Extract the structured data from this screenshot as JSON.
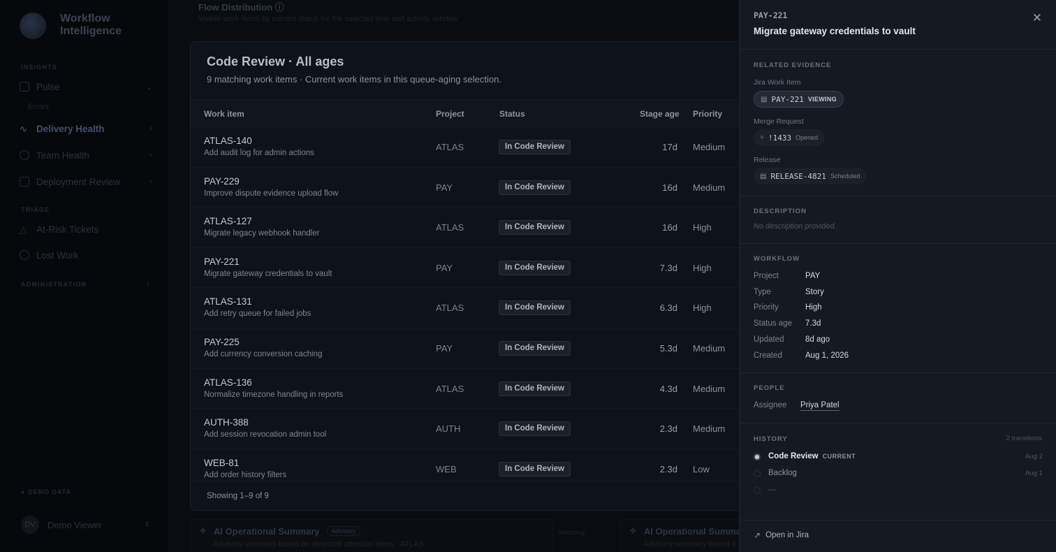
{
  "brand": {
    "name": "Workflow Intelligence"
  },
  "sidebar": {
    "section_insights": "INSIGHTS",
    "pulse": "Pulse",
    "pulse_sub": "Errors",
    "delivery_health": "Delivery Health",
    "team_health": "Team Health",
    "deployment_review": "Deployment Review",
    "section_triage": "TRIAGE",
    "at_risk": "At-Risk Tickets",
    "lost_work": "Lost Work",
    "section_admin": "ADMINISTRATION",
    "demo_tag": "DEMO DATA",
    "user_initials": "DV",
    "user_name": "Demo Viewer"
  },
  "background": {
    "flow_title": "Flow Distribution ⓘ",
    "flow_sub": "Visible work items by current status for the selected lens and activity window",
    "ai_title": "AI Operational Summary",
    "ai_badge": "Advisory",
    "ai_sub": "Advisory summary based on detected attention items · ATLAS",
    "ai_side": "Watching",
    "ai_title2": "AI Operational Summa",
    "ai_sub2": "Advisory summary based o"
  },
  "modal": {
    "title": "Code Review · All ages",
    "subtitle": "9 matching work items · Current work items in this queue-aging selection.",
    "columns": {
      "item": "Work item",
      "project": "Project",
      "status": "Status",
      "age": "Stage age",
      "priority": "Priority"
    },
    "rows": [
      {
        "id": "ATLAS-140",
        "title": "Add audit log for admin actions",
        "project": "ATLAS",
        "status": "In Code Review",
        "age": "17d",
        "priority": "Medium"
      },
      {
        "id": "PAY-229",
        "title": "Improve dispute evidence upload flow",
        "project": "PAY",
        "status": "In Code Review",
        "age": "16d",
        "priority": "Medium"
      },
      {
        "id": "ATLAS-127",
        "title": "Migrate legacy webhook handler",
        "project": "ATLAS",
        "status": "In Code Review",
        "age": "16d",
        "priority": "High"
      },
      {
        "id": "PAY-221",
        "title": "Migrate gateway credentials to vault",
        "project": "PAY",
        "status": "In Code Review",
        "age": "7.3d",
        "priority": "High"
      },
      {
        "id": "ATLAS-131",
        "title": "Add retry queue for failed jobs",
        "project": "ATLAS",
        "status": "In Code Review",
        "age": "6.3d",
        "priority": "High"
      },
      {
        "id": "PAY-225",
        "title": "Add currency conversion caching",
        "project": "PAY",
        "status": "In Code Review",
        "age": "5.3d",
        "priority": "Medium"
      },
      {
        "id": "ATLAS-136",
        "title": "Normalize timezone handling in reports",
        "project": "ATLAS",
        "status": "In Code Review",
        "age": "4.3d",
        "priority": "Medium"
      },
      {
        "id": "AUTH-388",
        "title": "Add session revocation admin tool",
        "project": "AUTH",
        "status": "In Code Review",
        "age": "2.3d",
        "priority": "Medium"
      },
      {
        "id": "WEB-81",
        "title": "Add order history filters",
        "project": "WEB",
        "status": "In Code Review",
        "age": "2.3d",
        "priority": "Low"
      }
    ],
    "footer": "Showing 1–9 of 9"
  },
  "panel": {
    "key": "PAY-221",
    "title": "Migrate gateway credentials to vault",
    "related_heading": "RELATED EVIDENCE",
    "jira_label": "Jira Work Item",
    "jira_key": "PAY-221",
    "jira_tag": "VIEWING",
    "mr_label": "Merge Request",
    "mr_key": "!1433",
    "mr_tag": "Opened",
    "release_label": "Release",
    "release_key": "RELEASE-4821",
    "release_tag": "Scheduled",
    "description_heading": "DESCRIPTION",
    "description_empty": "No description provided.",
    "workflow_heading": "WORKFLOW",
    "workflow": [
      {
        "k": "Project",
        "v": "PAY"
      },
      {
        "k": "Type",
        "v": "Story"
      },
      {
        "k": "Priority",
        "v": "High"
      },
      {
        "k": "Status age",
        "v": "7.3d"
      },
      {
        "k": "Updated",
        "v": "8d ago"
      },
      {
        "k": "Created",
        "v": "Aug 1, 2026"
      }
    ],
    "people_heading": "PEOPLE",
    "assignee_label": "Assignee",
    "assignee": "Priya Patel",
    "history_heading": "HISTORY",
    "history_count": "2 transitions",
    "history": [
      {
        "name": "Code Review",
        "tag": "CURRENT",
        "date": "Aug 2"
      },
      {
        "name": "Backlog",
        "tag": "",
        "date": "Aug 1"
      },
      {
        "name": "—",
        "tag": "",
        "date": ""
      }
    ],
    "open_link": "Open in Jira"
  }
}
